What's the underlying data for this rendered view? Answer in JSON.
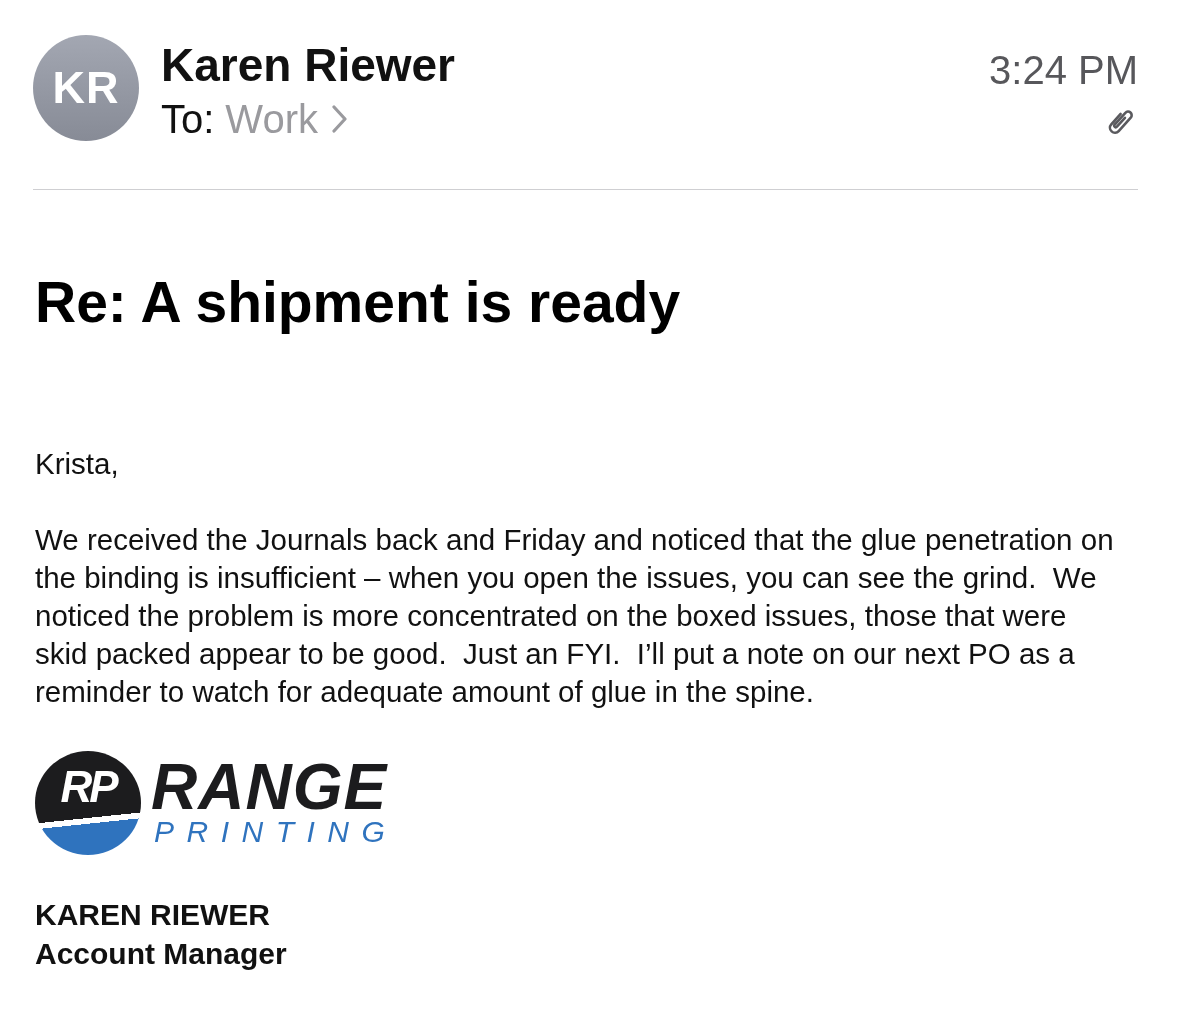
{
  "header": {
    "avatar": {
      "initials": "KR"
    },
    "sender": "Karen Riewer",
    "to_label": "To:",
    "recipient": "Work",
    "time": "3:24 PM",
    "has_attachment": true
  },
  "subject": "Re: A shipment is ready",
  "body": {
    "greeting": "Krista,",
    "paragraphs": [
      "We received the Journals back and Friday and noticed that the glue penetration on the binding is insufficient – when you open the issues, you can see the grind.  We noticed the problem is more concentrated on the boxed issues, those that were skid packed appear to be good.  Just an FYI.  I’ll put a note on our next PO as a reminder to watch for adequate amount of glue in the spine."
    ]
  },
  "signature": {
    "logo": {
      "monogram": "RP",
      "name": "RANGE",
      "tagline": "PRINTING"
    },
    "name": "KAREN RIEWER",
    "title": "Account Manager"
  }
}
